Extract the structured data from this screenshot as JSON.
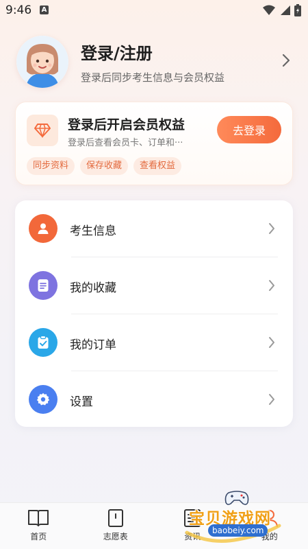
{
  "status": {
    "time": "9:46",
    "badge": "A"
  },
  "profile": {
    "title": "登录/注册",
    "subtitle": "登录后同步考生信息与会员权益"
  },
  "vip": {
    "title": "登录后开启会员权益",
    "subtitle": "登录后查看会员卡、订单和···",
    "button": "去登录",
    "tags": [
      "同步资料",
      "保存收藏",
      "查看权益"
    ],
    "accent": "#f46a3c"
  },
  "menu": {
    "items": [
      {
        "label": "考生信息",
        "icon": "person-icon",
        "color": "#f2683a"
      },
      {
        "label": "我的收藏",
        "icon": "document-icon",
        "color": "#7e73e0"
      },
      {
        "label": "我的订单",
        "icon": "clipboard-check-icon",
        "color": "#2aa7e8"
      },
      {
        "label": "设置",
        "icon": "gear-icon",
        "color": "#4a7ff0"
      }
    ]
  },
  "tabbar": {
    "items": [
      {
        "label": "首页",
        "icon": "book-icon"
      },
      {
        "label": "志愿表",
        "icon": "form-icon"
      },
      {
        "label": "资讯",
        "icon": "news-icon"
      },
      {
        "label": "我的",
        "icon": "profile-icon"
      }
    ]
  },
  "watermark": {
    "text": "宝贝游戏网",
    "url": "baobeiy.com"
  }
}
